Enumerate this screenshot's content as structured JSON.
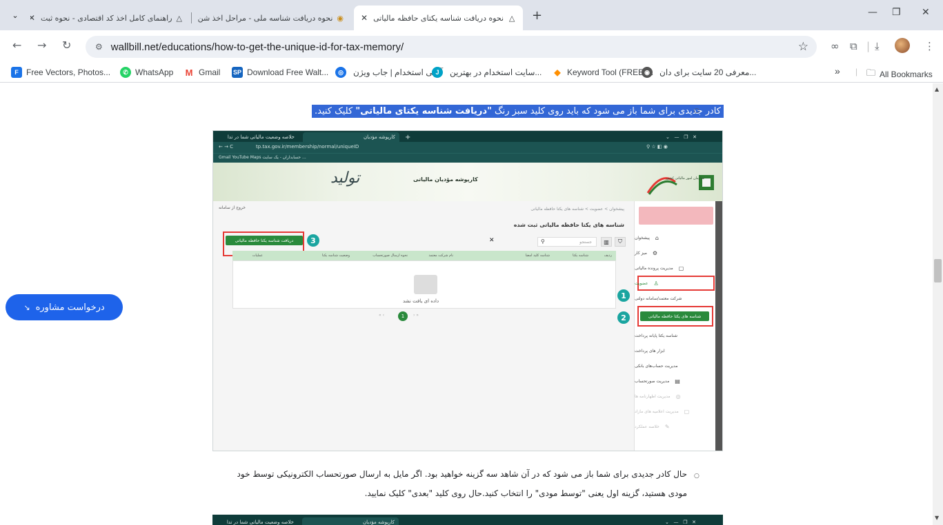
{
  "browser": {
    "tabs": [
      {
        "title": "راهنمای کامل اخذ کد اقتصادی - نحوه ثبت",
        "active": false
      },
      {
        "title": "نحوه دریافت شناسه ملی - مراحل اخذ شن",
        "active": false
      },
      {
        "title": "نحوه دریافت شناسه یکتای حافظه مالیاتی",
        "active": true
      }
    ],
    "new_tab": "+",
    "window_controls": {
      "minimize": "—",
      "restore": "❐",
      "close": "✕"
    },
    "url": "wallbill.net/educations/how-to-get-the-unique-id-for-tax-memory/",
    "bookmarks": [
      {
        "label": "Free Vectors, Photos...",
        "color": "#1a73e8",
        "glyph": "F"
      },
      {
        "label": "WhatsApp",
        "color": "#25d366",
        "glyph": "✆"
      },
      {
        "label": "Gmail",
        "color": "#ea4335",
        "glyph": "M"
      },
      {
        "label": "Download Free Walt...",
        "color": "#1565c0",
        "glyph": "SP"
      },
      {
        "label": "آگهی استخدام | جاب ویژن",
        "color": "#1a73e8",
        "glyph": "◎"
      },
      {
        "label": "سایت استخدام در بهترین...",
        "color": "#00a2c7",
        "glyph": "J"
      },
      {
        "label": "Keyword Tool (FREE)...",
        "color": "#ff8f00",
        "glyph": "◆"
      },
      {
        "label": "معرفی 20 سایت برای دان...",
        "color": "#555555",
        "glyph": "◉"
      }
    ],
    "overflow": "»",
    "all_bookmarks": "All Bookmarks"
  },
  "article": {
    "highlight_pre": "کادر جدیدی برای شما باز می شود که باید روی کلید سبز رنگ ",
    "highlight_bold": "\"دریافت شناسه یکتای مالیاتی\"",
    "highlight_post": " کلیک کنید.",
    "para_line1": "حال کادر جدیدی برای شما باز می شود که در آن شاهد سه گزینه خواهید بود. اگر مایل به ارسال صورتحساب الکترونیکی توسط خود",
    "para_line2": "مودی هستید، گزینه اول یعنی \"توسط مودی\" را انتخاب کنید.حال روی کلید \"بعدی\" کلیک نمایید."
  },
  "consult_button": "درخواست مشاوره",
  "screenshot": {
    "tabs": [
      "خلاصه وضعیت مالیاتی شما در تدا",
      "کارپوشه مؤدیان"
    ],
    "url": "tp.tax.gov.ir/membership/normal/uniqueID",
    "bookmarks": "Gmail   YouTube   Maps   حسابداران - یک سایت ...",
    "banner_title": "کارپوشه مؤدیان مالیاتی",
    "logo_text": "تولید",
    "org_name": "سازمان امور مالیاتی کشور",
    "breadcrumb": "پیشخوان  >  عضویت  >  شناسه های یکتا حافظه مالیاتی",
    "exit": "خروج از سامانه",
    "page_title": "شناسه های یکتا حافظه مالیاتی ثبت شده",
    "get_button": "دریافت شناسه یکتا حافظه مالیاتی",
    "search_placeholder": "جستجو",
    "columns": [
      "ردیف",
      "شناسه یکتا",
      "شناسه کلید امضا",
      "نام شرکت معتمد",
      "نحوه ارسال صورتحساب",
      "وضعیت شناسه یکتا",
      "عملیات"
    ],
    "empty": "داده ای یافت نشد",
    "menu": [
      {
        "label": "پیشخوان",
        "icon": "⌂",
        "dim": false
      },
      {
        "label": "میز کار",
        "icon": "⚙",
        "dim": false
      },
      {
        "label": "مدیریت پرونده مالیاتی",
        "icon": "▢",
        "dim": false
      },
      {
        "label": "عضویت",
        "icon": "♙",
        "dim": false
      },
      {
        "label": "شرکت معتمد/سامانه دولتی",
        "icon": "",
        "dim": false
      },
      {
        "label": "شناسه یکتا پایانه پرداخت",
        "icon": "",
        "dim": false
      },
      {
        "label": "ابزار های پرداخت",
        "icon": "",
        "dim": false
      },
      {
        "label": "مدیریت حساب‌های بانکی",
        "icon": "",
        "dim": false
      },
      {
        "label": "مدیریت صورتحساب",
        "icon": "▤",
        "dim": false
      },
      {
        "label": "مدیریت اظهارنامه ها",
        "icon": "◎",
        "dim": true
      },
      {
        "label": "مدیریت اعلامیه های مازاد",
        "icon": "▢",
        "dim": true
      },
      {
        "label": "خلاصه عملکرد",
        "icon": "✎",
        "dim": true
      }
    ],
    "side_active": "شناسه های یکتا حافظه مالیاتی",
    "step_numbers": [
      "1",
      "2",
      "3"
    ],
    "pager_current": "1"
  },
  "colors": {
    "accent": "#3367d6",
    "consult": "#1e63ea",
    "green": "#2a8a3c",
    "teal": "#1aa5a0",
    "red": "#e53935"
  }
}
